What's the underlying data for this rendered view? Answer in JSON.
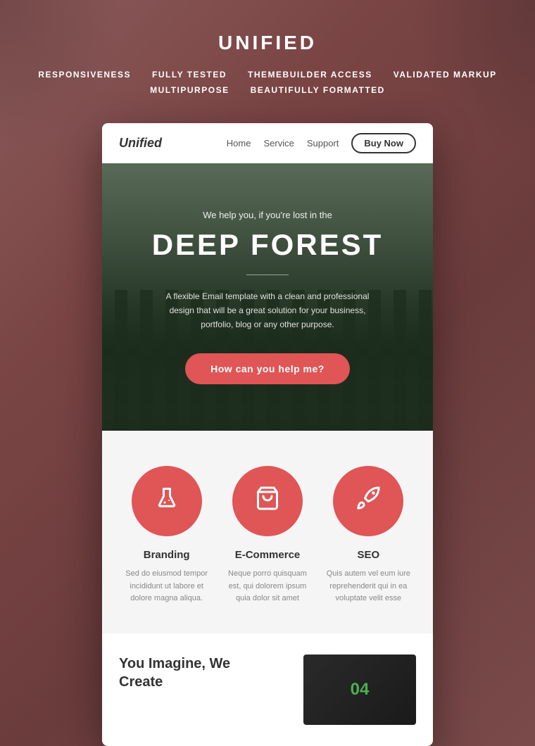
{
  "header": {
    "title": "UNIFIED",
    "features": [
      "RESPONSIVENESS",
      "FULLY TESTED",
      "THEMEBUILDER ACCESS",
      "VALIDATED MARKUP",
      "MULTIPURPOSE",
      "BEAUTIFULLY FORMATTED"
    ]
  },
  "nav": {
    "logo": "Unified",
    "links": [
      "Home",
      "Service",
      "Support"
    ],
    "cta": "Buy Now"
  },
  "hero": {
    "subtitle": "We help you, if you're lost in the",
    "title": "DEEP FOREST",
    "description": "A flexible Email template with a clean and professional design that will be a great solution for your business, portfolio, blog or any other purpose.",
    "cta": "How can you help me?"
  },
  "services": {
    "items": [
      {
        "id": "branding",
        "title": "Branding",
        "description": "Sed do eiusmod tempor incididunt ut labore et dolore magna aliqua.",
        "icon": "flask"
      },
      {
        "id": "ecommerce",
        "title": "E-Commerce",
        "description": "Neque porro quisquam est, qui dolorem ipsum quia dolor sit amet",
        "icon": "bag"
      },
      {
        "id": "seo",
        "title": "SEO",
        "description": "Quis autem vel eum iure reprehenderit qui in ea voluptate velit esse",
        "icon": "rocket"
      }
    ]
  },
  "bottom": {
    "title_line1": "You Imagine, We",
    "title_line2": "Create",
    "image_text": "04"
  },
  "colors": {
    "accent": "#e05555",
    "bg_dark": "#7a4a4a",
    "text_dark": "#333333"
  }
}
